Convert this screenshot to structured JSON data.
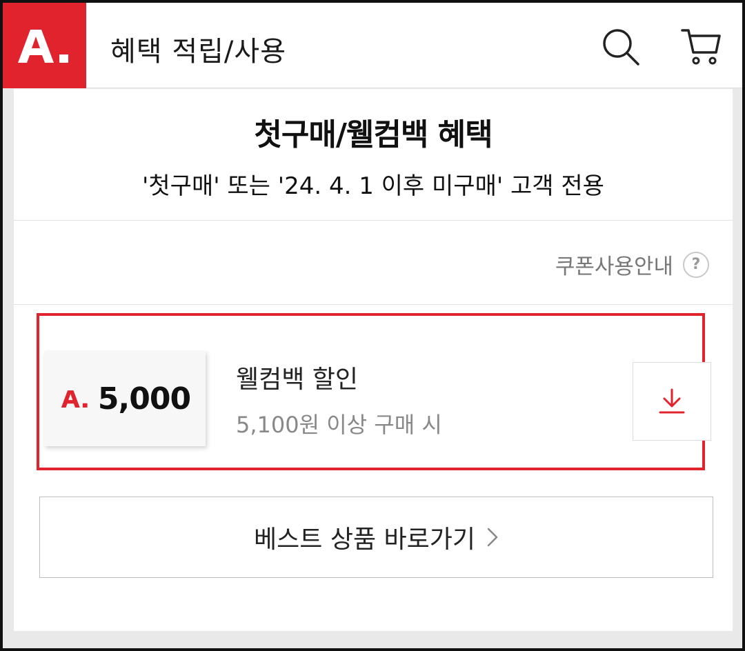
{
  "header": {
    "logo_icon": "a-dot-logo",
    "title": "혜택 적립/사용",
    "search_icon": "search-icon",
    "cart_icon": "cart-icon"
  },
  "benefit": {
    "title": "첫구매/웰컴백 혜택",
    "subtitle": "'첫구매' 또는 '24. 4. 1 이후 미구매' 고객 전용"
  },
  "coupon_guide": {
    "label": "쿠폰사용안내",
    "icon": "help-icon",
    "icon_glyph": "?"
  },
  "coupon": {
    "amount": "5,000",
    "name": "웰컴백 할인",
    "condition": "5,100원 이상 구매 시",
    "download_icon": "download-icon"
  },
  "best_products": {
    "label": "베스트 상품 바로가기"
  },
  "colors": {
    "brand_red": "#e0232c",
    "text_dark": "#111111",
    "text_gray": "#888888",
    "background": "#e9e9e9"
  }
}
